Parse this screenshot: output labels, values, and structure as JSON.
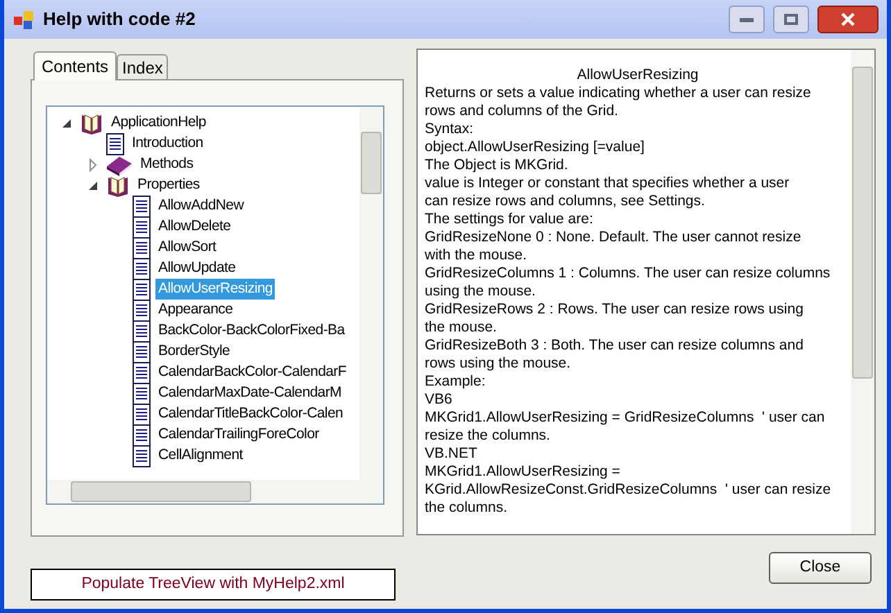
{
  "window": {
    "title": "Help with code #2"
  },
  "tabs": [
    {
      "label": "Contents",
      "selected": true
    },
    {
      "label": "Index",
      "selected": false
    }
  ],
  "tree": [
    {
      "label": "ApplicationHelp",
      "kind": "book",
      "expanded": true,
      "selected": false,
      "children": [
        {
          "label": "Introduction",
          "kind": "page",
          "selected": false
        },
        {
          "label": "Methods",
          "kind": "closedbook",
          "expanded": false,
          "selected": false
        },
        {
          "label": "Properties",
          "kind": "book",
          "expanded": true,
          "selected": false,
          "children": [
            {
              "label": "AllowAddNew",
              "kind": "page",
              "selected": false
            },
            {
              "label": "AllowDelete",
              "kind": "page",
              "selected": false
            },
            {
              "label": "AllowSort",
              "kind": "page",
              "selected": false
            },
            {
              "label": "AllowUpdate",
              "kind": "page",
              "selected": false
            },
            {
              "label": "AllowUserResizing",
              "kind": "page",
              "selected": true
            },
            {
              "label": "Appearance",
              "kind": "page",
              "selected": false
            },
            {
              "label": "BackColor-BackColorFixed-Ba",
              "kind": "page",
              "selected": false
            },
            {
              "label": "BorderStyle",
              "kind": "page",
              "selected": false
            },
            {
              "label": "CalendarBackColor-CalendarF",
              "kind": "page",
              "selected": false
            },
            {
              "label": "CalendarMaxDate-CalendarM",
              "kind": "page",
              "selected": false
            },
            {
              "label": "CalendarTitleBackColor-Calen",
              "kind": "page",
              "selected": false
            },
            {
              "label": "CalendarTrailingForeColor",
              "kind": "page",
              "selected": false
            },
            {
              "label": "CellAlignment",
              "kind": "page",
              "selected": false
            }
          ]
        }
      ]
    }
  ],
  "populate_button": "Populate TreeView with MyHelp2.xml",
  "help_text": {
    "title": "AllowUserResizing",
    "lines": [
      "Returns or sets a value indicating whether a user can resize",
      "rows and columns of the Grid.",
      "Syntax:",
      "object.AllowUserResizing [=value]",
      "The Object is MKGrid.",
      "value is Integer or constant that specifies whether a user",
      "can resize rows and columns, see Settings.",
      "The settings for value are:",
      "GridResizeNone 0 : None. Default. The user cannot resize",
      "with the mouse.",
      "GridResizeColumns 1 : Columns. The user can resize columns",
      "using the mouse.",
      "GridResizeRows 2 : Rows. The user can resize rows using",
      "the mouse.",
      "GridResizeBoth 3 : Both. The user can resize columns and",
      "rows using the mouse.",
      "Example:",
      "VB6",
      "MKGrid1.AllowUserResizing = GridResizeColumns  ' user can",
      "resize the columns.",
      "VB.NET",
      "MKGrid1.AllowUserResizing =",
      "KGrid.AllowResizeConst.GridResizeColumns  ' user can resize",
      "the columns."
    ]
  },
  "close_button": "Close"
}
